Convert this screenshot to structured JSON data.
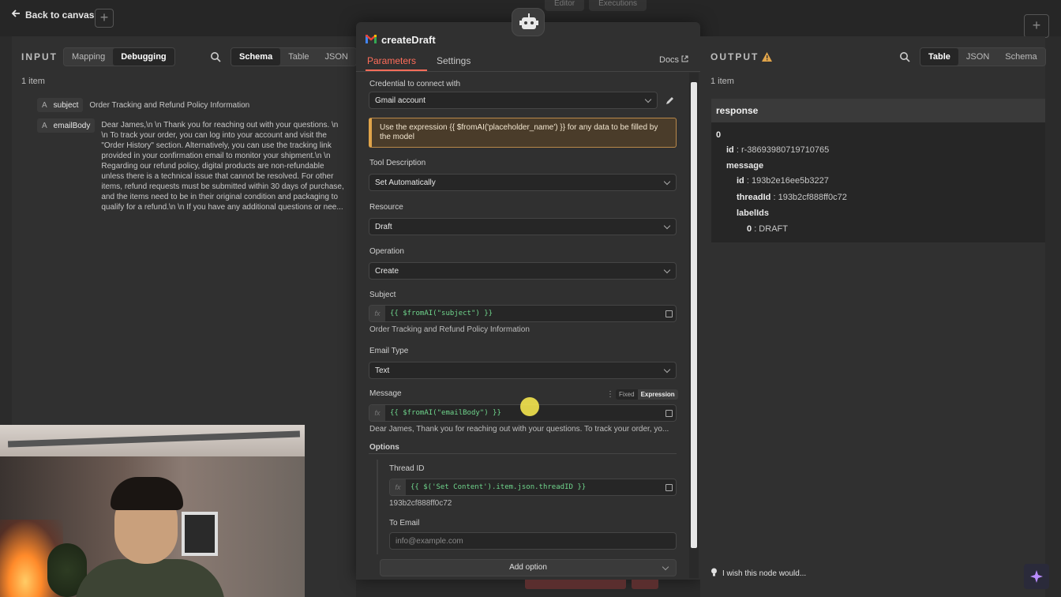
{
  "header": {
    "back_label": "Back to canvas",
    "top_tabs": [
      "Editor",
      "Executions"
    ]
  },
  "input": {
    "title": "INPUT",
    "mode_tabs": [
      "Mapping",
      "Debugging"
    ],
    "view_tabs": [
      "Schema",
      "Table",
      "JSON"
    ],
    "item_count": "1 item",
    "fields": [
      {
        "type": "A",
        "key": "subject",
        "value": "Order Tracking and Refund Policy Information"
      },
      {
        "type": "A",
        "key": "emailBody",
        "value": "Dear James,\\n \\n Thank you for reaching out with your questions. \\n \\n To track your order, you can log into your account and visit the \"Order History\" section. Alternatively, you can use the tracking link provided in your confirmation email to monitor your shipment.\\n \\n Regarding our refund policy, digital products are non-refundable unless there is a technical issue that cannot be resolved. For other items, refund requests must be submitted within 30 days of purchase, and the items need to be in their original condition and packaging to qualify for a refund.\\n \\n If you have any additional questions or nee..."
      }
    ]
  },
  "node": {
    "title": "createDraft",
    "tabs": [
      "Parameters",
      "Settings"
    ],
    "docs_label": "Docs",
    "credential_label": "Credential to connect with",
    "credential_value": "Gmail account",
    "notice": "Use the expression {{ $fromAI('placeholder_name') }} for any data to be filled by the model",
    "tool_description_label": "Tool Description",
    "tool_description_value": "Set Automatically",
    "resource_label": "Resource",
    "resource_value": "Draft",
    "operation_label": "Operation",
    "operation_value": "Create",
    "subject_label": "Subject",
    "subject_expr": "{{ $fromAI(\"subject\") }}",
    "subject_preview": "Order Tracking and Refund Policy Information",
    "email_type_label": "Email Type",
    "email_type_value": "Text",
    "message_label": "Message",
    "toggle": [
      "Fixed",
      "Expression"
    ],
    "message_expr": "{{ $fromAI(\"emailBody\") }}",
    "message_preview": "Dear James, Thank you for reaching out with your questions.  To track your order, yo...",
    "options_label": "Options",
    "thread_id_label": "Thread ID",
    "thread_id_expr": "{{ $('Set Content').item.json.threadID }}",
    "thread_id_preview": "193b2cf888ff0c72",
    "to_email_label": "To Email",
    "to_email_placeholder": "info@example.com",
    "add_option_label": "Add option"
  },
  "output": {
    "title": "OUTPUT",
    "view_tabs": [
      "Table",
      "JSON",
      "Schema"
    ],
    "item_count": "1 item",
    "response_label": "response",
    "index0": "0",
    "id_key": "id",
    "id_value": ": r-3869398071971076​5",
    "message_key": "message",
    "msg_id_key": "id",
    "msg_id_value": ": 193b2e16ee5b3227",
    "thread_key": "threadId",
    "thread_value": ": 193b2cf888ff0c72",
    "labels_key": "labelIds",
    "label0_key": "0",
    "label0_value": ": DRAFT",
    "wish_label": "I wish this node would..."
  },
  "colors": {
    "accent": "#ff6d5a",
    "expr_green": "#6fd58c",
    "warning": "#e0a44a"
  }
}
